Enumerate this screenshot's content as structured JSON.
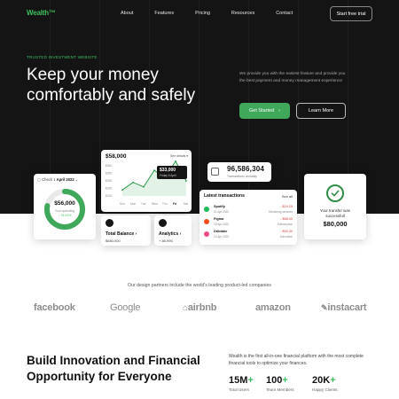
{
  "brand": {
    "logo": "Wealth™",
    "accent": "#3fbf5e",
    "hero_bg": "#141414"
  },
  "nav": {
    "links": [
      "About",
      "Features",
      "Pricing",
      "Resources",
      "Contact"
    ],
    "cta": "Start free trial"
  },
  "hero": {
    "eyebrow": "TRUSTED INVESTMENT WEBSITE",
    "headline": "Keep your money comfortably and safely",
    "description": "We provide you with the easiest feature and provide you the best payment and money management experience",
    "primary_button": "Get Started",
    "secondary_button": "Learn More"
  },
  "widgets": {
    "checkin": {
      "period_prefix": "Check 1",
      "period_date": "April 2022",
      "amount": "$56,000",
      "sub_label": "Your spending",
      "sub_change": "↑ +6.03%",
      "progress_fraction": 0.78
    },
    "chart_card": {
      "amount": "$58,000",
      "see_details": "See details ▾",
      "tooltip_amount": "$33,000",
      "tooltip_date": "Friday 6 April",
      "days": [
        "Sun",
        "Mon",
        "Tue",
        "Wed",
        "Thu",
        "Fri",
        "Sat"
      ],
      "y_ticks": [
        "$30K",
        "$25K",
        "$20K",
        "$15K",
        "$10K"
      ]
    },
    "balance": {
      "label": "Total Balance",
      "value": "$580,000"
    },
    "analytics": {
      "label": "Analytics",
      "value": "+ 86,995"
    },
    "transactions_count": {
      "value": "96,586,304",
      "label": "Transactions annually"
    },
    "transactions": {
      "title": "Latest transactions",
      "see_all": "See all",
      "rows": [
        {
          "name": "Spotify",
          "date": "21 Apr 2022",
          "amount": "- $19.29",
          "category": "Streaming services",
          "color": "#1db954"
        },
        {
          "name": "Figma",
          "date": "18 Apr 2022",
          "amount": "- $58.00",
          "category": "Subscription",
          "color": "#f24e1e"
        },
        {
          "name": "Dribbble",
          "date": "10 Apr 2022",
          "amount": "- $99.30",
          "category": "Annuation",
          "color": "#ea4c89"
        }
      ]
    },
    "success": {
      "message": "Your transfer was successfull",
      "amount": "$80,000"
    }
  },
  "chart_data": {
    "type": "area",
    "categories": [
      "Sun",
      "Mon",
      "Tue",
      "Wed",
      "Thu",
      "Fri",
      "Sat"
    ],
    "series": [
      {
        "values": [
          14,
          19,
          16,
          27,
          22,
          33,
          20
        ]
      }
    ],
    "ylim": [
      10,
      30
    ],
    "y_ticks": [
      "$30K",
      "$25K",
      "$20K",
      "$15K",
      "$10K"
    ],
    "grid": false
  },
  "partners": {
    "title": "Our design partners include the world's leading product-led companies",
    "logos": [
      "facebook",
      "Google",
      "airbnb",
      "amazon",
      "instacart"
    ]
  },
  "section2": {
    "title": "Build Innovation and Financial Opportunity for Everyone",
    "description": "Wealth is the first all-in-one financial platform with the most complete financial tools to optimize your finances.",
    "stats": [
      {
        "value": "15M",
        "plus": "+",
        "label": "Total Users"
      },
      {
        "value": "100",
        "plus": "+",
        "label": "Team Members"
      },
      {
        "value": "20K",
        "plus": "+",
        "label": "Happy Clients"
      }
    ]
  }
}
